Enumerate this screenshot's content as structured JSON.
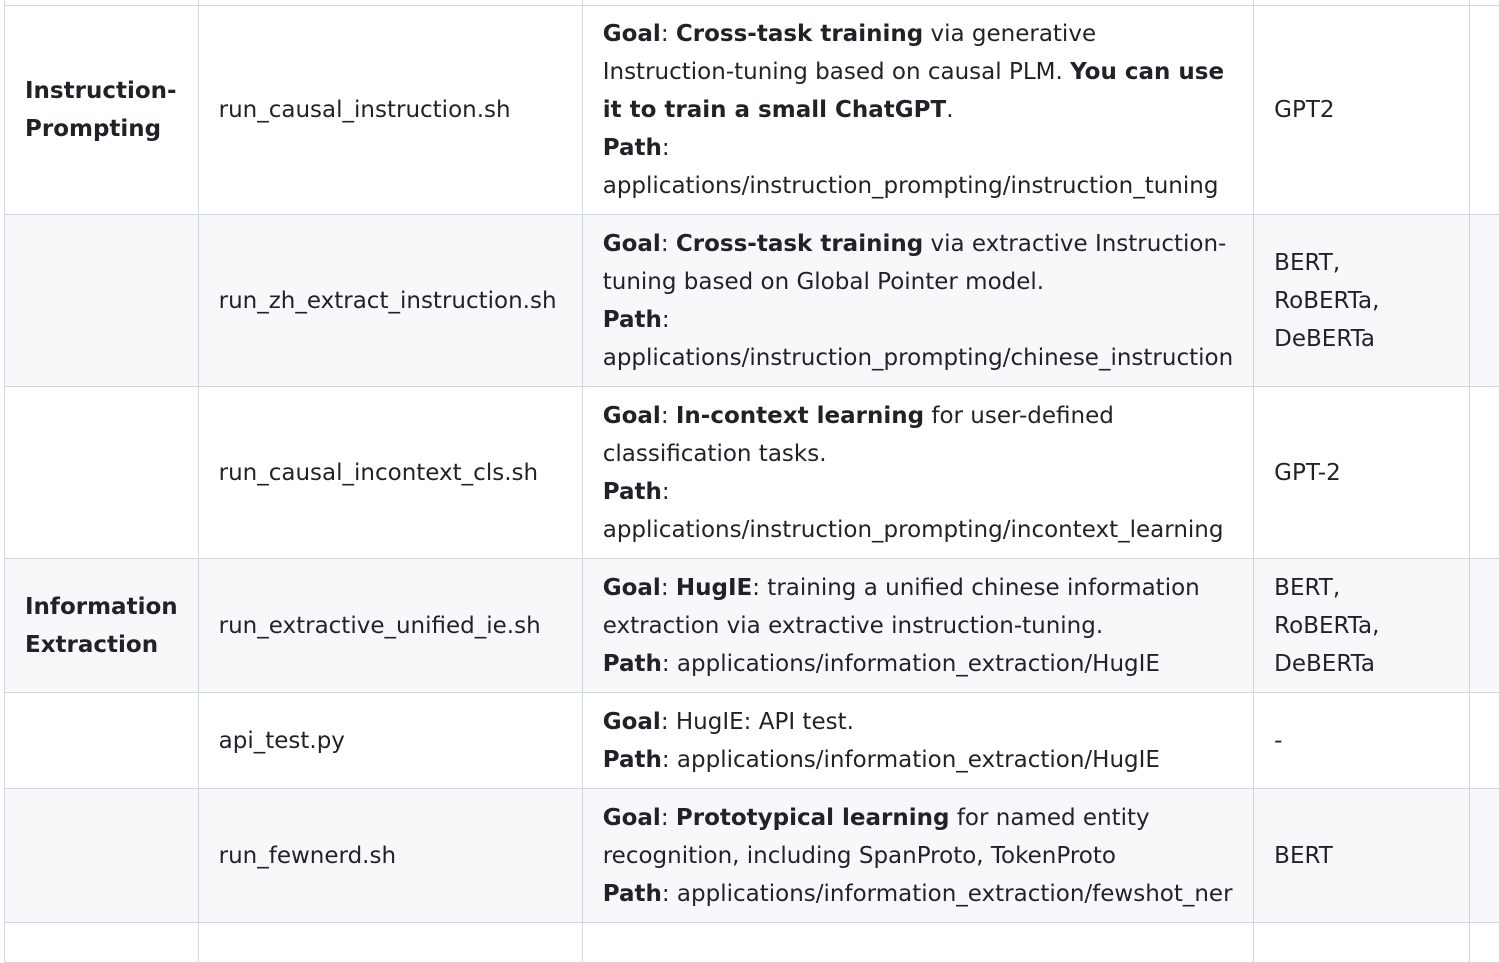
{
  "rows": [
    {
      "category": "",
      "script": "",
      "goal_label": "",
      "goal_bold": "",
      "goal_text": "",
      "path_label": "",
      "path": "",
      "models": ""
    },
    {
      "category": "Instruction-Prompting",
      "script": "run_causal_instruction.sh",
      "goal_label": "Goal",
      "goal_bold": "Cross-task training",
      "goal_text": "via generative Instruction-tuning based on causal PLM.",
      "goal_bold2": "You can use it to train a small ChatGPT",
      "goal_tail": ".",
      "path_label": "Path",
      "path": "applications/instruction_prompting/instruction_tuning",
      "models": "GPT2"
    },
    {
      "category": "",
      "script": "run_zh_extract_instruction.sh",
      "goal_label": "Goal",
      "goal_bold": "Cross-task training",
      "goal_text": "via extractive Instruction-tuning based on Global Pointer model.",
      "path_label": "Path",
      "path": "applications/instruction_prompting/chinese_instruction",
      "models": "BERT, RoBERTa, DeBERTa"
    },
    {
      "category": "",
      "script": "run_causal_incontext_cls.sh",
      "goal_label": "Goal",
      "goal_bold": "In-context learning",
      "goal_text": "for user-defined classification tasks.",
      "path_label": "Path",
      "path": "applications/instruction_prompting/incontext_learning",
      "models": "GPT-2"
    },
    {
      "category": "Information Extraction",
      "script": "run_extractive_unified_ie.sh",
      "goal_label": "Goal",
      "goal_bold": "HugIE",
      "goal_text": ": training a unified chinese information extraction via extractive instruction-tuning.",
      "path_label": "Path",
      "path": "applications/information_extraction/HugIE",
      "models": "BERT, RoBERTa, DeBERTa"
    },
    {
      "category": "",
      "script": "api_test.py",
      "goal_label": "Goal",
      "goal_bold": "",
      "goal_text": "HugIE: API test.",
      "path_label": "Path",
      "path": "applications/information_extraction/HugIE",
      "models": "-"
    },
    {
      "category": "",
      "script": "run_fewnerd.sh",
      "goal_label": "Goal",
      "goal_bold": "Prototypical learning",
      "goal_text": "for named entity recognition, including SpanProto, TokenProto",
      "path_label": "Path",
      "path": "applications/information_extraction/fewshot_ner",
      "models": "BERT"
    },
    {
      "category": "",
      "script": "",
      "goal_label": "",
      "goal_bold": "",
      "goal_text": "",
      "path_label": "",
      "path": "",
      "models": ""
    }
  ]
}
